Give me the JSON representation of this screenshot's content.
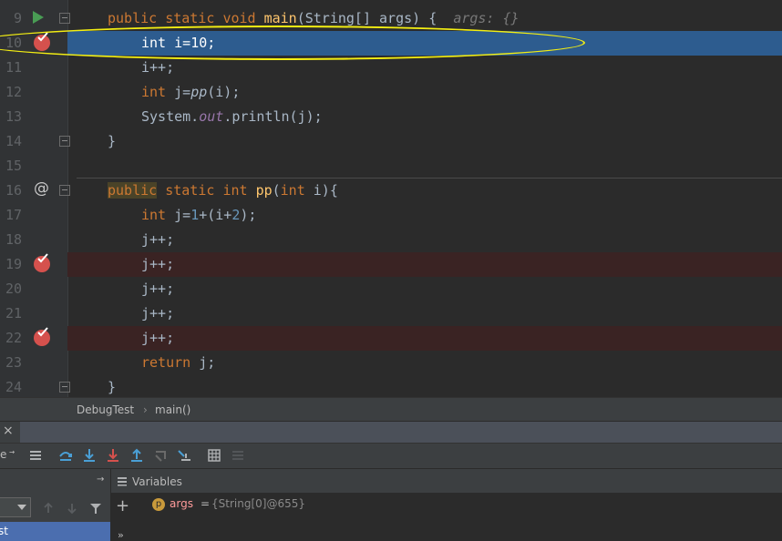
{
  "editor": {
    "lines": [
      {
        "n": "9",
        "text": ""
      },
      {
        "n": "10",
        "text": ""
      },
      {
        "n": "11",
        "text": ""
      },
      {
        "n": "12",
        "text": ""
      },
      {
        "n": "13",
        "text": ""
      },
      {
        "n": "14",
        "text": ""
      },
      {
        "n": "15",
        "text": ""
      },
      {
        "n": "16",
        "text": ""
      },
      {
        "n": "17",
        "text": ""
      },
      {
        "n": "18",
        "text": ""
      },
      {
        "n": "19",
        "text": ""
      },
      {
        "n": "20",
        "text": ""
      },
      {
        "n": "21",
        "text": ""
      },
      {
        "n": "22",
        "text": ""
      },
      {
        "n": "23",
        "text": ""
      },
      {
        "n": "24",
        "text": ""
      }
    ],
    "tokens": {
      "public": "public",
      "static": "static",
      "void": "void",
      "int": "int",
      "return": "return",
      "main": "main",
      "main_params": "(String[] args) {",
      "param_hint": "args: {}",
      "l10_var": "i=",
      "l10_num": "10",
      "semi": ";",
      "l11": "i++;",
      "l12_var": "j=",
      "l12_call": "pp",
      "l12_arg": "(i);",
      "l13_sys": "System.",
      "l13_out": "out",
      "l13_rest": ".println(j);",
      "close_brace": "}",
      "pp": "pp",
      "pp_open": "(",
      "pp_param": "i){",
      "l17_var": "j=",
      "l17_num1": "1",
      "l17_mid": "+(i+",
      "l17_num2": "2",
      "l17_end": ");",
      "jinc": "j++;",
      "ret_val": "j;"
    },
    "execution_line": "10",
    "breakpoint_lines": [
      "10",
      "19",
      "22"
    ]
  },
  "breadcrumb": {
    "class_name": "DebugTest",
    "separator": "›",
    "method": "main()"
  },
  "debug_tabs": {
    "close": "×"
  },
  "toolbar": {
    "left_label": "e",
    "buttons": [
      "layout-icon",
      "step-over-icon",
      "step-into-icon",
      "force-step-into-icon",
      "step-out-icon",
      "drop-frame-icon",
      "run-to-cursor-icon",
      "evaluate-icon",
      "trace-icon"
    ]
  },
  "panel": {
    "variables_title": "Variables",
    "pin_glyph": "→",
    "frame_tab_label": "st"
  },
  "variables": [
    {
      "badge": "p",
      "name": "args",
      "eq": "=",
      "value": "{String[0]@655}"
    }
  ],
  "colors": {
    "editor_bg": "#2b2b2b",
    "exec_line": "#2d5c8f",
    "breakpoint_line": "#3a2323",
    "keyword": "#cc7832",
    "number": "#6897bb",
    "function": "#ffc66d",
    "static_field": "#9876aa",
    "annotation_ring": "#f4ef12",
    "breakpoint": "#d5514d"
  }
}
